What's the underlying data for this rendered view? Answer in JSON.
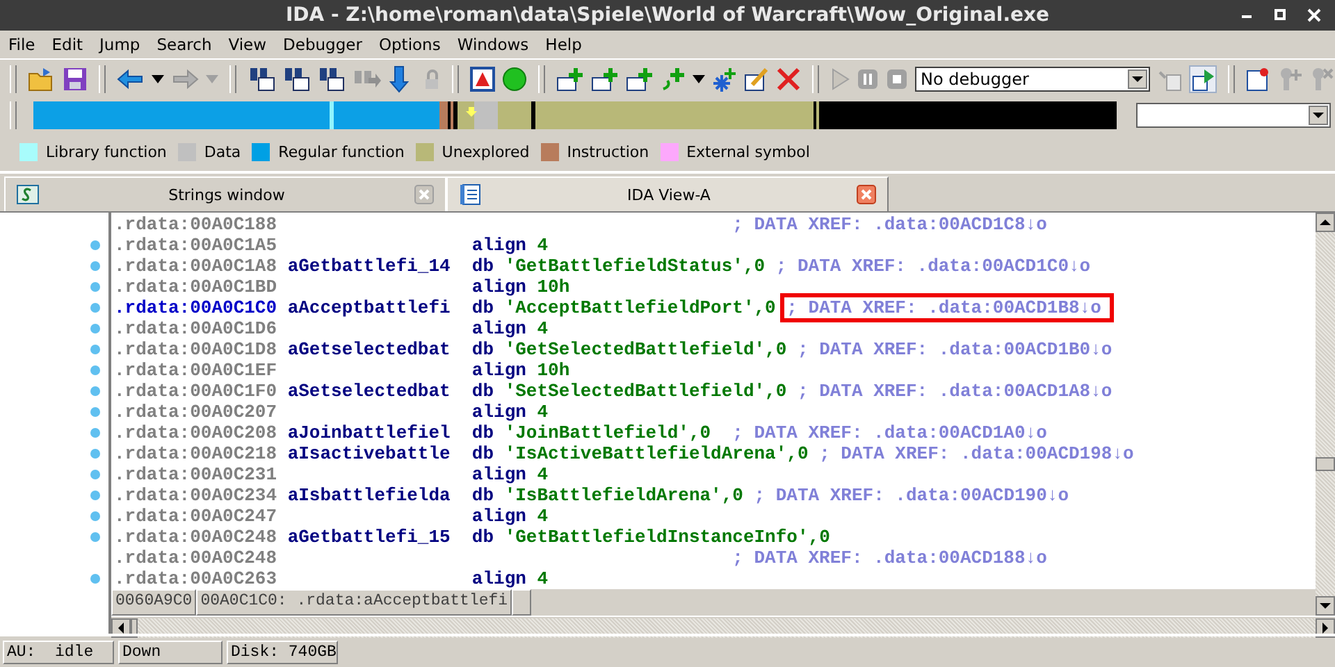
{
  "window": {
    "title": "IDA - Z:\\home\\roman\\data\\Spiele\\World of Warcraft\\Wow_Original.exe"
  },
  "menu": [
    "File",
    "Edit",
    "Jump",
    "Search",
    "View",
    "Debugger",
    "Options",
    "Windows",
    "Help"
  ],
  "toolbar": {
    "debugger_select": {
      "value": "No debugger"
    }
  },
  "legend": [
    {
      "label": "Library function",
      "color": "#a8fcfc"
    },
    {
      "label": "Data",
      "color": "#c0c0c0"
    },
    {
      "label": "Regular function",
      "color": "#00a0e4"
    },
    {
      "label": "Unexplored",
      "color": "#b8b878"
    },
    {
      "label": "Instruction",
      "color": "#b87c5c"
    },
    {
      "label": "External symbol",
      "color": "#fca8fc"
    }
  ],
  "tabs": [
    {
      "label": "Strings window",
      "selected": false
    },
    {
      "label": "IDA View-A",
      "selected": true
    }
  ],
  "listing": {
    "rows": [
      {
        "address": ".rdata:00A0C188",
        "comment": "; DATA XREF: .data:00ACD1C8↓o",
        "dot": false,
        "selected": false,
        "highlighted": false
      },
      {
        "address": ".rdata:00A0C1A5",
        "mnemonic": "align",
        "operand": "4",
        "dot": true,
        "selected": false,
        "highlighted": false
      },
      {
        "address": ".rdata:00A0C1A8",
        "name": "aGetbattlefi_14",
        "mnemonic": "db",
        "operand": "'GetBattlefieldStatus',0",
        "comment": "; DATA XREF: .data:00ACD1C0↓o",
        "dot": true,
        "selected": false,
        "highlighted": false
      },
      {
        "address": ".rdata:00A0C1BD",
        "mnemonic": "align",
        "operand": "10h",
        "dot": true,
        "selected": false,
        "highlighted": false
      },
      {
        "address": ".rdata:00A0C1C0",
        "name": "aAcceptbattlefi",
        "mnemonic": "db",
        "operand": "'AcceptBattlefieldPort',0",
        "comment": "; DATA XREF: .data:00ACD1B8↓o",
        "dot": true,
        "selected": true,
        "highlighted": true
      },
      {
        "address": ".rdata:00A0C1D6",
        "mnemonic": "align",
        "operand": "4",
        "dot": true,
        "selected": false,
        "highlighted": false
      },
      {
        "address": ".rdata:00A0C1D8",
        "name": "aGetselectedbat",
        "mnemonic": "db",
        "operand": "'GetSelectedBattlefield',0",
        "comment": "; DATA XREF: .data:00ACD1B0↓o",
        "dot": true,
        "selected": false,
        "highlighted": false
      },
      {
        "address": ".rdata:00A0C1EF",
        "mnemonic": "align",
        "operand": "10h",
        "dot": true,
        "selected": false,
        "highlighted": false
      },
      {
        "address": ".rdata:00A0C1F0",
        "name": "aSetselectedbat",
        "mnemonic": "db",
        "operand": "'SetSelectedBattlefield',0",
        "comment": "; DATA XREF: .data:00ACD1A8↓o",
        "dot": true,
        "selected": false,
        "highlighted": false
      },
      {
        "address": ".rdata:00A0C207",
        "mnemonic": "align",
        "operand": "4",
        "dot": true,
        "selected": false,
        "highlighted": false
      },
      {
        "address": ".rdata:00A0C208",
        "name": "aJoinbattlefiel",
        "mnemonic": "db",
        "operand": "'JoinBattlefield',0",
        "comment": "; DATA XREF: .data:00ACD1A0↓o",
        "dot": true,
        "selected": false,
        "highlighted": false
      },
      {
        "address": ".rdata:00A0C218",
        "name": "aIsactivebattle",
        "mnemonic": "db",
        "operand": "'IsActiveBattlefieldArena',0",
        "comment": "; DATA XREF: .data:00ACD198↓o",
        "dot": true,
        "selected": false,
        "highlighted": false
      },
      {
        "address": ".rdata:00A0C231",
        "mnemonic": "align",
        "operand": "4",
        "dot": true,
        "selected": false,
        "highlighted": false
      },
      {
        "address": ".rdata:00A0C234",
        "name": "aIsbattlefielda",
        "mnemonic": "db",
        "operand": "'IsBattlefieldArena',0",
        "comment": "; DATA XREF: .data:00ACD190↓o",
        "dot": true,
        "selected": false,
        "highlighted": false
      },
      {
        "address": ".rdata:00A0C247",
        "mnemonic": "align",
        "operand": "4",
        "dot": true,
        "selected": false,
        "highlighted": false
      },
      {
        "address": ".rdata:00A0C248",
        "name": "aGetbattlefi_15",
        "mnemonic": "db",
        "operand": "'GetBattlefieldInstanceInfo',0",
        "dot": true,
        "selected": false,
        "highlighted": false
      },
      {
        "address": ".rdata:00A0C248",
        "comment": "; DATA XREF: .data:00ACD188↓o",
        "dot": false,
        "selected": false,
        "highlighted": false
      },
      {
        "address": ".rdata:00A0C263",
        "mnemonic": "align",
        "operand": "4",
        "dot": true,
        "selected": false,
        "highlighted": false
      }
    ]
  },
  "view_status": {
    "offset": "0060A9C0",
    "location": "00A0C1C0: .rdata:aAcceptbattlefi"
  },
  "status_bar": [
    "AU:  idle",
    "Down",
    "Disk: 740GB"
  ]
}
